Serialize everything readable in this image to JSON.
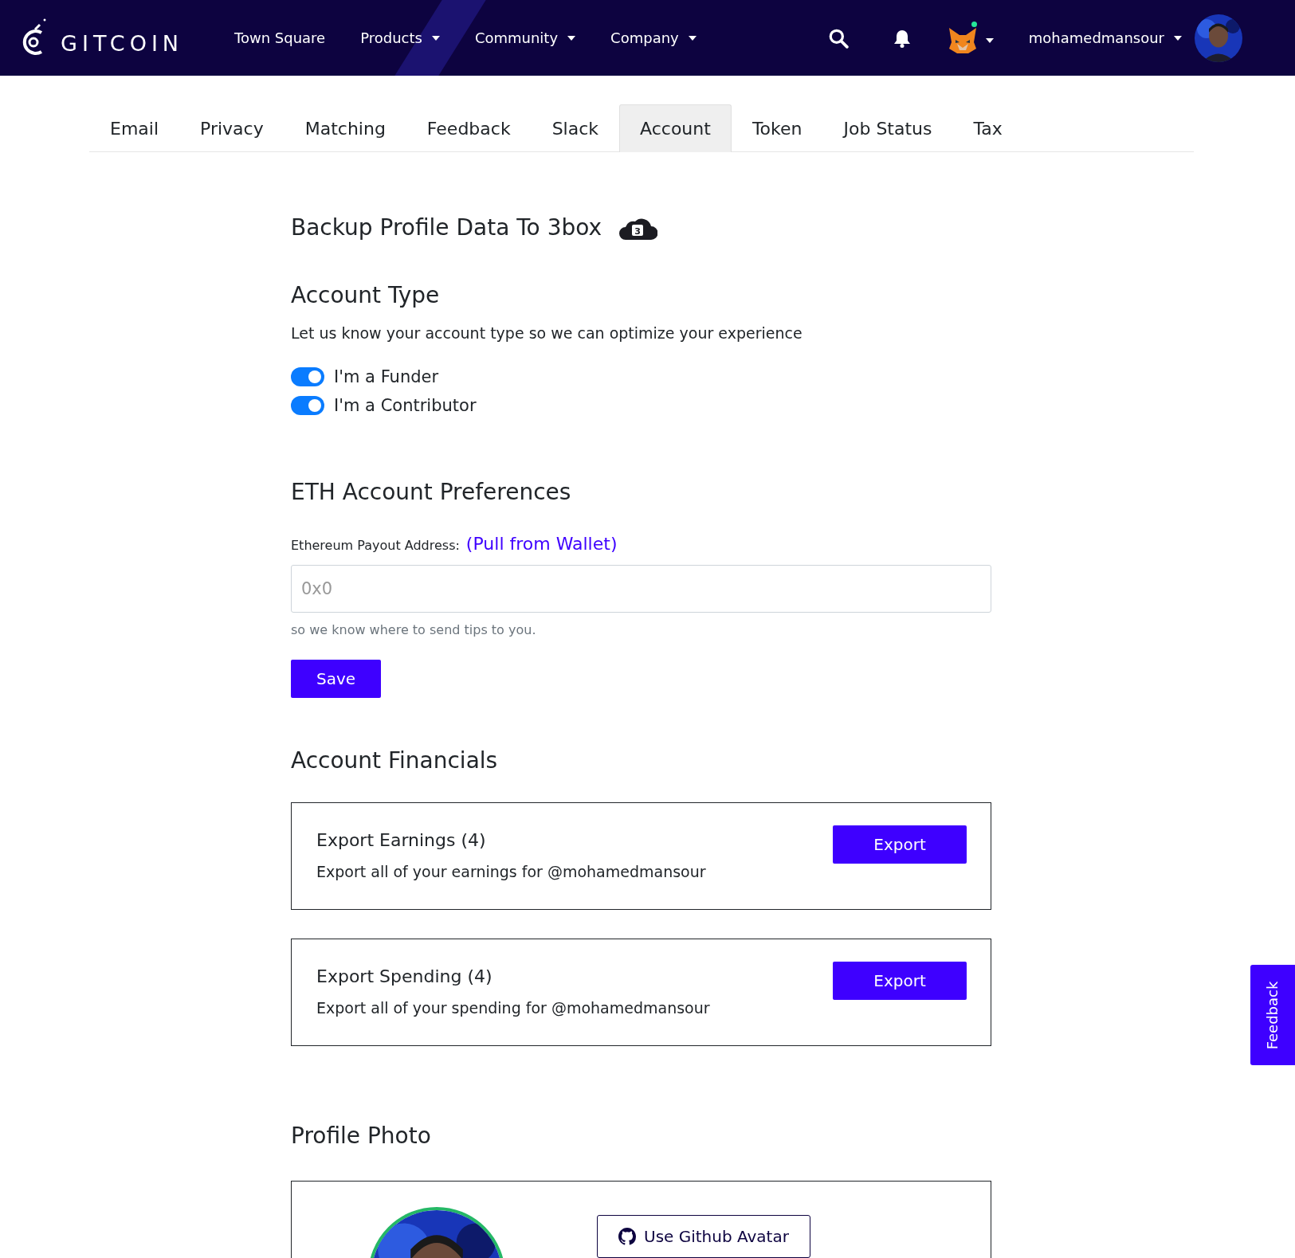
{
  "header": {
    "logo": "GITCOIN",
    "nav": [
      {
        "label": "Town Square",
        "dropdown": false
      },
      {
        "label": "Products",
        "dropdown": true
      },
      {
        "label": "Community",
        "dropdown": true
      },
      {
        "label": "Company",
        "dropdown": true
      }
    ],
    "wallet_connected": true,
    "username": "mohamedmansour"
  },
  "tabs": [
    {
      "label": "Email",
      "selected": false
    },
    {
      "label": "Privacy",
      "selected": false
    },
    {
      "label": "Matching",
      "selected": false
    },
    {
      "label": "Feedback",
      "selected": false
    },
    {
      "label": "Slack",
      "selected": false
    },
    {
      "label": "Account",
      "selected": true
    },
    {
      "label": "Token",
      "selected": false
    },
    {
      "label": "Job Status",
      "selected": false
    },
    {
      "label": "Tax",
      "selected": false
    }
  ],
  "backup": {
    "title": "Backup Profile Data To 3box",
    "badge": "3"
  },
  "account_type": {
    "title": "Account Type",
    "description": "Let us know your account type so we can optimize your experience",
    "toggles": [
      {
        "label": "I'm a Funder",
        "on": true
      },
      {
        "label": "I'm a Contributor",
        "on": true
      }
    ]
  },
  "eth": {
    "title": "ETH Account Preferences",
    "field_label": "Ethereum Payout Address:",
    "link": "(Pull from Wallet)",
    "placeholder": "0x0",
    "help": "so we know where to send tips to you.",
    "save": "Save"
  },
  "financials": {
    "title": "Account Financials",
    "cards": [
      {
        "title": "Export Earnings (4)",
        "description": "Export all of your earnings for @mohamedmansour",
        "button": "Export"
      },
      {
        "title": "Export Spending (4)",
        "description": "Export all of your spending for @mohamedmansour",
        "button": "Export"
      }
    ]
  },
  "profile_photo": {
    "title": "Profile Photo",
    "github_button": "Use Github Avatar"
  },
  "feedback_tab": "Feedback"
}
